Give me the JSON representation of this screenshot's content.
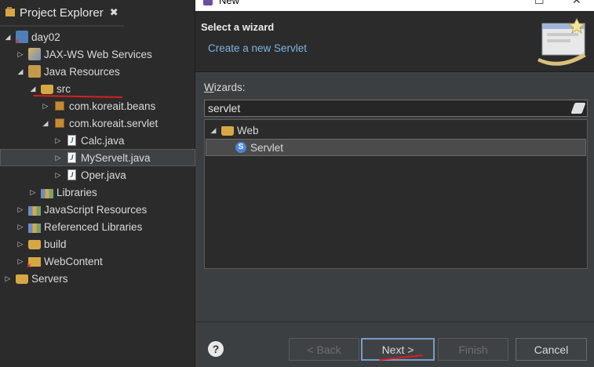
{
  "project_explorer": {
    "tab_title": "Project Explorer",
    "tab_close": "✖",
    "tree": [
      {
        "label": "day02",
        "icon": "project-error-icon",
        "expanded": true
      },
      {
        "label": "JAX-WS Web Services",
        "icon": "web-services-icon"
      },
      {
        "label": "Java Resources",
        "icon": "java-resources-icon",
        "expanded": true
      },
      {
        "label": "src",
        "icon": "source-folder-icon",
        "expanded": true
      },
      {
        "label": "com.koreait.beans",
        "icon": "package-icon"
      },
      {
        "label": "com.koreait.servlet",
        "icon": "package-icon",
        "expanded": true
      },
      {
        "label": "Calc.java",
        "icon": "java-file-icon"
      },
      {
        "label": "MyServelt.java",
        "icon": "java-file-icon",
        "selected": true
      },
      {
        "label": "Oper.java",
        "icon": "java-file-icon"
      },
      {
        "label": "Libraries",
        "icon": "libraries-icon"
      },
      {
        "label": "JavaScript Resources",
        "icon": "js-resources-icon"
      },
      {
        "label": "Referenced Libraries",
        "icon": "referenced-libraries-icon"
      },
      {
        "label": "build",
        "icon": "folder-icon"
      },
      {
        "label": "WebContent",
        "icon": "web-content-icon"
      },
      {
        "label": "Servers",
        "icon": "folder-icon"
      }
    ]
  },
  "dialog": {
    "title": "New",
    "header_title": "Select a wizard",
    "header_subtitle": "Create a new Servlet",
    "wizards_label_prefix": "W",
    "wizards_label_rest": "izards:",
    "filter_value": "servlet",
    "wizard_tree": [
      {
        "label": "Web",
        "icon": "folder-open-icon",
        "expanded": true
      },
      {
        "label": "Servlet",
        "icon": "servlet-icon",
        "selected": true
      }
    ],
    "buttons": {
      "back": "< Back",
      "next": "Next >",
      "finish": "Finish",
      "cancel": "Cancel"
    },
    "help": "?"
  },
  "colors": {
    "accent_link": "#78b5e3",
    "annotation_red": "#d81f1f"
  }
}
